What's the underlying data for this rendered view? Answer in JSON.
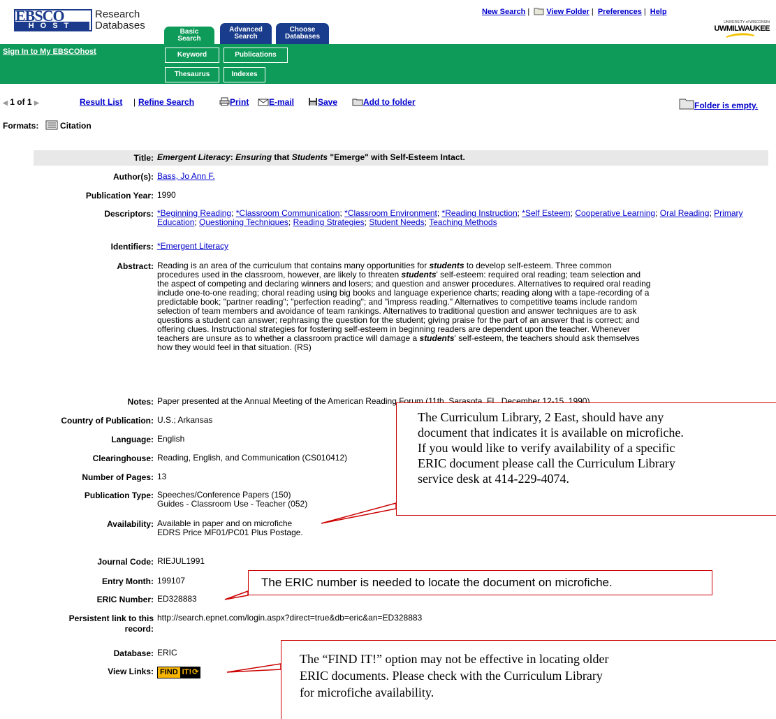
{
  "header": {
    "logo_ebsco": "EBSCO",
    "logo_host": "HOST",
    "logo_research": "Research",
    "logo_databases": "Databases",
    "tabs": [
      {
        "line1": "Basic",
        "line2": "Search"
      },
      {
        "line1": "Advanced",
        "line2": "Search"
      },
      {
        "line1": "Choose",
        "line2": "Databases"
      }
    ],
    "top_links": {
      "new_search": "New Search",
      "view_folder": "View Folder",
      "preferences": "Preferences",
      "help": "Help"
    },
    "uwm_small": "UNIVERSITY of WISCONSIN",
    "uwm_big": "UWMILWAUKEE"
  },
  "greenbar": {
    "sign_in": "Sign In to My EBSCOhost",
    "keyword": "Keyword",
    "publications": "Publications",
    "thesaurus": "Thesaurus",
    "indexes": "Indexes"
  },
  "nav": {
    "counter": "1 of 1",
    "result_list": "Result List",
    "refine_search": "Refine Search",
    "print": "Print",
    "email": "E-mail",
    "save": "Save",
    "add_to_folder": "Add to folder",
    "folder_empty": "Folder is empty."
  },
  "formats": {
    "label": "Formats:",
    "citation": "Citation"
  },
  "record": {
    "title_label": "Title:",
    "title_parts": [
      "Emergent Literacy",
      ": ",
      "Ensuring",
      " that ",
      "Students",
      " \"Emerge\" with Self-Esteem Intact."
    ],
    "authors_label": "Author(s):",
    "authors": "Bass, Jo Ann F.",
    "year_label": "Publication Year:",
    "year": "1990",
    "descriptors_label": "Descriptors:",
    "descriptors": [
      "*Beginning Reading",
      "*Classroom Communication",
      "*Classroom Environment",
      "*Reading Instruction",
      "*Self Esteem",
      "Cooperative Learning",
      "Oral Reading",
      "Primary Education",
      "Questioning Techniques",
      "Reading Strategies",
      "Student Needs",
      "Teaching Methods"
    ],
    "identifiers_label": "Identifiers:",
    "identifiers": "*Emergent Literacy",
    "abstract_label": "Abstract:",
    "abstract_lines": [
      "Reading is an area of the curriculum that contains many opportunities for |students| to develop self-esteem. Three common",
      "procedures used in the classroom, however, are likely to threaten |students|' self-esteem: required oral reading; team selection and",
      "the aspect of competing and declaring winners and losers; and question and answer procedures. Alternatives to required oral reading",
      "include one-to-one reading; choral reading using big books and language experience charts; reading along with a tape-recording of a",
      "predictable book; \"partner reading\"; \"perfection reading\"; and \"impress reading.\" Alternatives to competitive teams include random",
      "selection of team members and avoidance of team rankings. Alternatives to traditional question and answer techniques are to ask",
      "questions a student can answer; rephrasing the question for the student; giving praise for the part of an answer that is correct; and",
      "offering clues. Instructional strategies for fostering self-esteem in beginning readers are dependent upon the teacher. Whenever",
      "teachers are unsure as to whether a classroom practice will damage a |students|' self-esteem, the teachers should ask themselves",
      "how they would feel in that situation. (RS)"
    ],
    "notes_label": "Notes:",
    "notes": "Paper presented at the Annual Meeting of the American Reading Forum (11th, Sarasota, FL, December 12-15, 1990).",
    "country_label": "Country of Publication:",
    "country": "U.S.; Arkansas",
    "language_label": "Language:",
    "language": "English",
    "clearinghouse_label": "Clearinghouse:",
    "clearinghouse": "Reading, English, and Communication (CS010412)",
    "pages_label": "Number of Pages:",
    "pages": "13",
    "pubtype_label": "Publication Type:",
    "pubtype_lines": [
      "Speeches/Conference Papers (150)",
      "Guides - Classroom Use - Teacher (052)"
    ],
    "availability_label": "Availability:",
    "availability_lines": [
      "Available in paper and on microfiche",
      "EDRS Price MF01/PC01 Plus Postage."
    ],
    "journal_label": "Journal Code:",
    "journal": "RIEJUL1991",
    "entry_label": "Entry Month:",
    "entry": "199107",
    "eric_label": "ERIC Number:",
    "eric": "ED328883",
    "persistent_label_lines": [
      "Persistent link to this",
      "record:"
    ],
    "persistent": "http://search.epnet.com/login.aspx?direct=true&db=eric&an=ED328883",
    "database_label": "Database:",
    "database": "ERIC",
    "viewlinks_label": "View Links:",
    "findit_parts": [
      "FIND",
      "IT!"
    ]
  },
  "callouts": {
    "library_lines": [
      "The Curriculum Library, 2 East, should have any",
      "document that indicates it is available on microfiche.",
      "If you would like to verify availability of a specific",
      "ERIC document please call the Curriculum Library",
      "service desk at 414-229-4074."
    ],
    "eric_note": "The ERIC number is needed to locate the document on microfiche.",
    "findit_lines": [
      "The “FIND IT!” option may not be effective in locating older",
      "ERIC documents.  Please check with the Curriculum Library",
      "for microfiche availability."
    ]
  },
  "colors": {
    "green": "#0e9a58",
    "navy": "#1a3c8c",
    "link": "#0000cc",
    "callout_border": "#cc0000"
  }
}
